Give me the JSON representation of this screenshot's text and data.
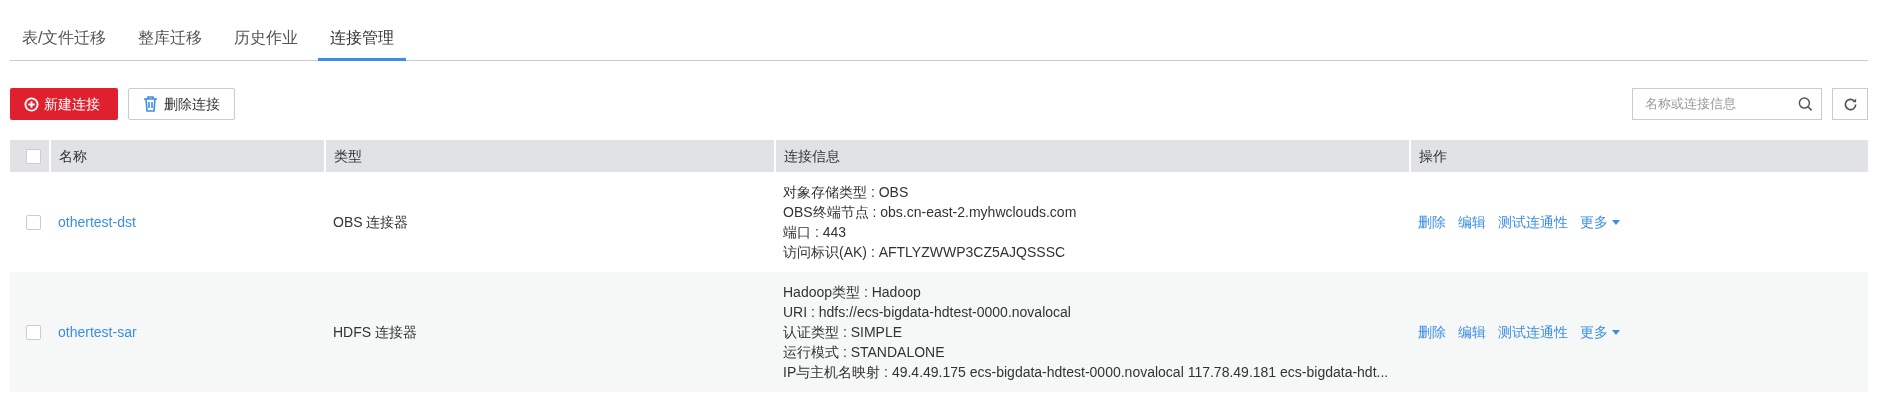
{
  "tabs": [
    {
      "label": "表/文件迁移",
      "selected": false
    },
    {
      "label": "整库迁移",
      "selected": false
    },
    {
      "label": "历史作业",
      "selected": false
    },
    {
      "label": "连接管理",
      "selected": true
    }
  ],
  "toolbar": {
    "create_button": "新建连接",
    "delete_button": "删除连接",
    "search": {
      "placeholder": "名称或连接信息"
    }
  },
  "table": {
    "columns": [
      "名称",
      "类型",
      "连接信息",
      "操作"
    ],
    "select_all_checked": false,
    "rows": [
      {
        "name": "othertest-dst",
        "type": "OBS 连接器",
        "checked": false,
        "info": [
          "对象存储类型 : OBS",
          "OBS终端节点 : obs.cn-east-2.myhwclouds.com",
          "端口 : 443",
          "访问标识(AK) : AFTLYZWWP3CZ5AJQSSSC"
        ],
        "actions": [
          "删除",
          "编辑",
          "测试连通性"
        ],
        "more": "更多"
      },
      {
        "name": "othertest-sar",
        "type": "HDFS 连接器",
        "checked": false,
        "info": [
          "Hadoop类型 : Hadoop",
          "URI : hdfs://ecs-bigdata-hdtest-0000.novalocal",
          "认证类型 : SIMPLE",
          "运行模式 : STANDALONE",
          "IP与主机名映射 : 49.4.49.175 ecs-bigdata-hdtest-0000.novalocal 117.78.49.181 ecs-bigdata-hdt..."
        ],
        "actions": [
          "删除",
          "编辑",
          "测试连通性"
        ],
        "more": "更多"
      }
    ]
  }
}
